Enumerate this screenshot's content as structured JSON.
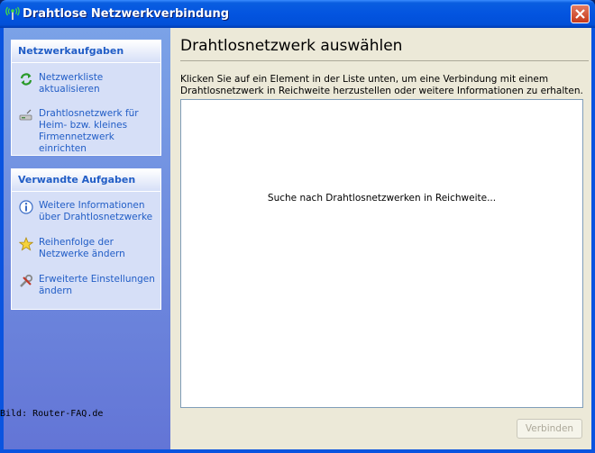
{
  "window": {
    "title": "Drahtlose Netzwerkverbindung"
  },
  "sidebar": {
    "network_tasks": {
      "header": "Netzwerkaufgaben",
      "items": [
        {
          "label": "Netzwerkliste aktualisieren",
          "icon": "refresh-icon"
        },
        {
          "label": "Drahtlosnetzwerk für\nHeim- bzw. kleines\nFirmennetzwerk einrichten",
          "icon": "wireless-setup-icon"
        }
      ]
    },
    "related_tasks": {
      "header": "Verwandte Aufgaben",
      "items": [
        {
          "label": "Weitere Informationen\nüber Drahtlosnetzwerke",
          "icon": "info-icon"
        },
        {
          "label": "Reihenfolge der\nNetzwerke ändern",
          "icon": "star-icon"
        },
        {
          "label": "Erweiterte Einstellungen\nändern",
          "icon": "settings-icon"
        }
      ]
    }
  },
  "main": {
    "title": "Drahtlosnetzwerk auswählen",
    "instructions": "Klicken Sie auf ein Element in der Liste unten, um eine Verbindung mit einem Drahtlosnetzwerk in Reichweite herzustellen oder weitere Informationen zu erhalten.",
    "list_status": "Suche nach Drahtlosnetzwerken in Reichweite...",
    "connect_label": "Verbinden"
  },
  "credit": "Bild: Router-FAQ.de",
  "colors": {
    "title_bar": "#0354e0",
    "link": "#215dc6",
    "panel": "#d6dff7",
    "face": "#ece9d8"
  }
}
